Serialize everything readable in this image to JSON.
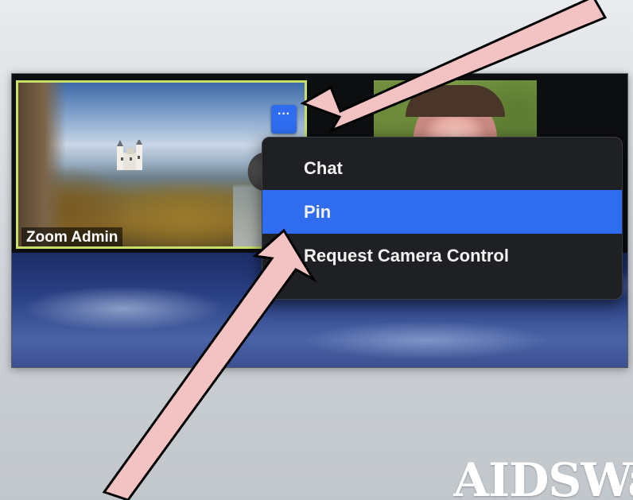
{
  "participant": {
    "name": "Zoom Admin",
    "more_button_label": "···"
  },
  "context_menu": {
    "items": [
      {
        "label": "Chat"
      },
      {
        "label": "Pin"
      },
      {
        "label": "Request Camera Control"
      }
    ],
    "active_item": "Pin"
  },
  "watermark": {
    "text": "AIDSWat"
  },
  "colors": {
    "active_tile_border": "#c8e06a",
    "accent_blue": "#2f6cf0",
    "menu_background": "#1f2023",
    "arrow_fill": "#f3c2c2",
    "arrow_outline": "#000000"
  }
}
